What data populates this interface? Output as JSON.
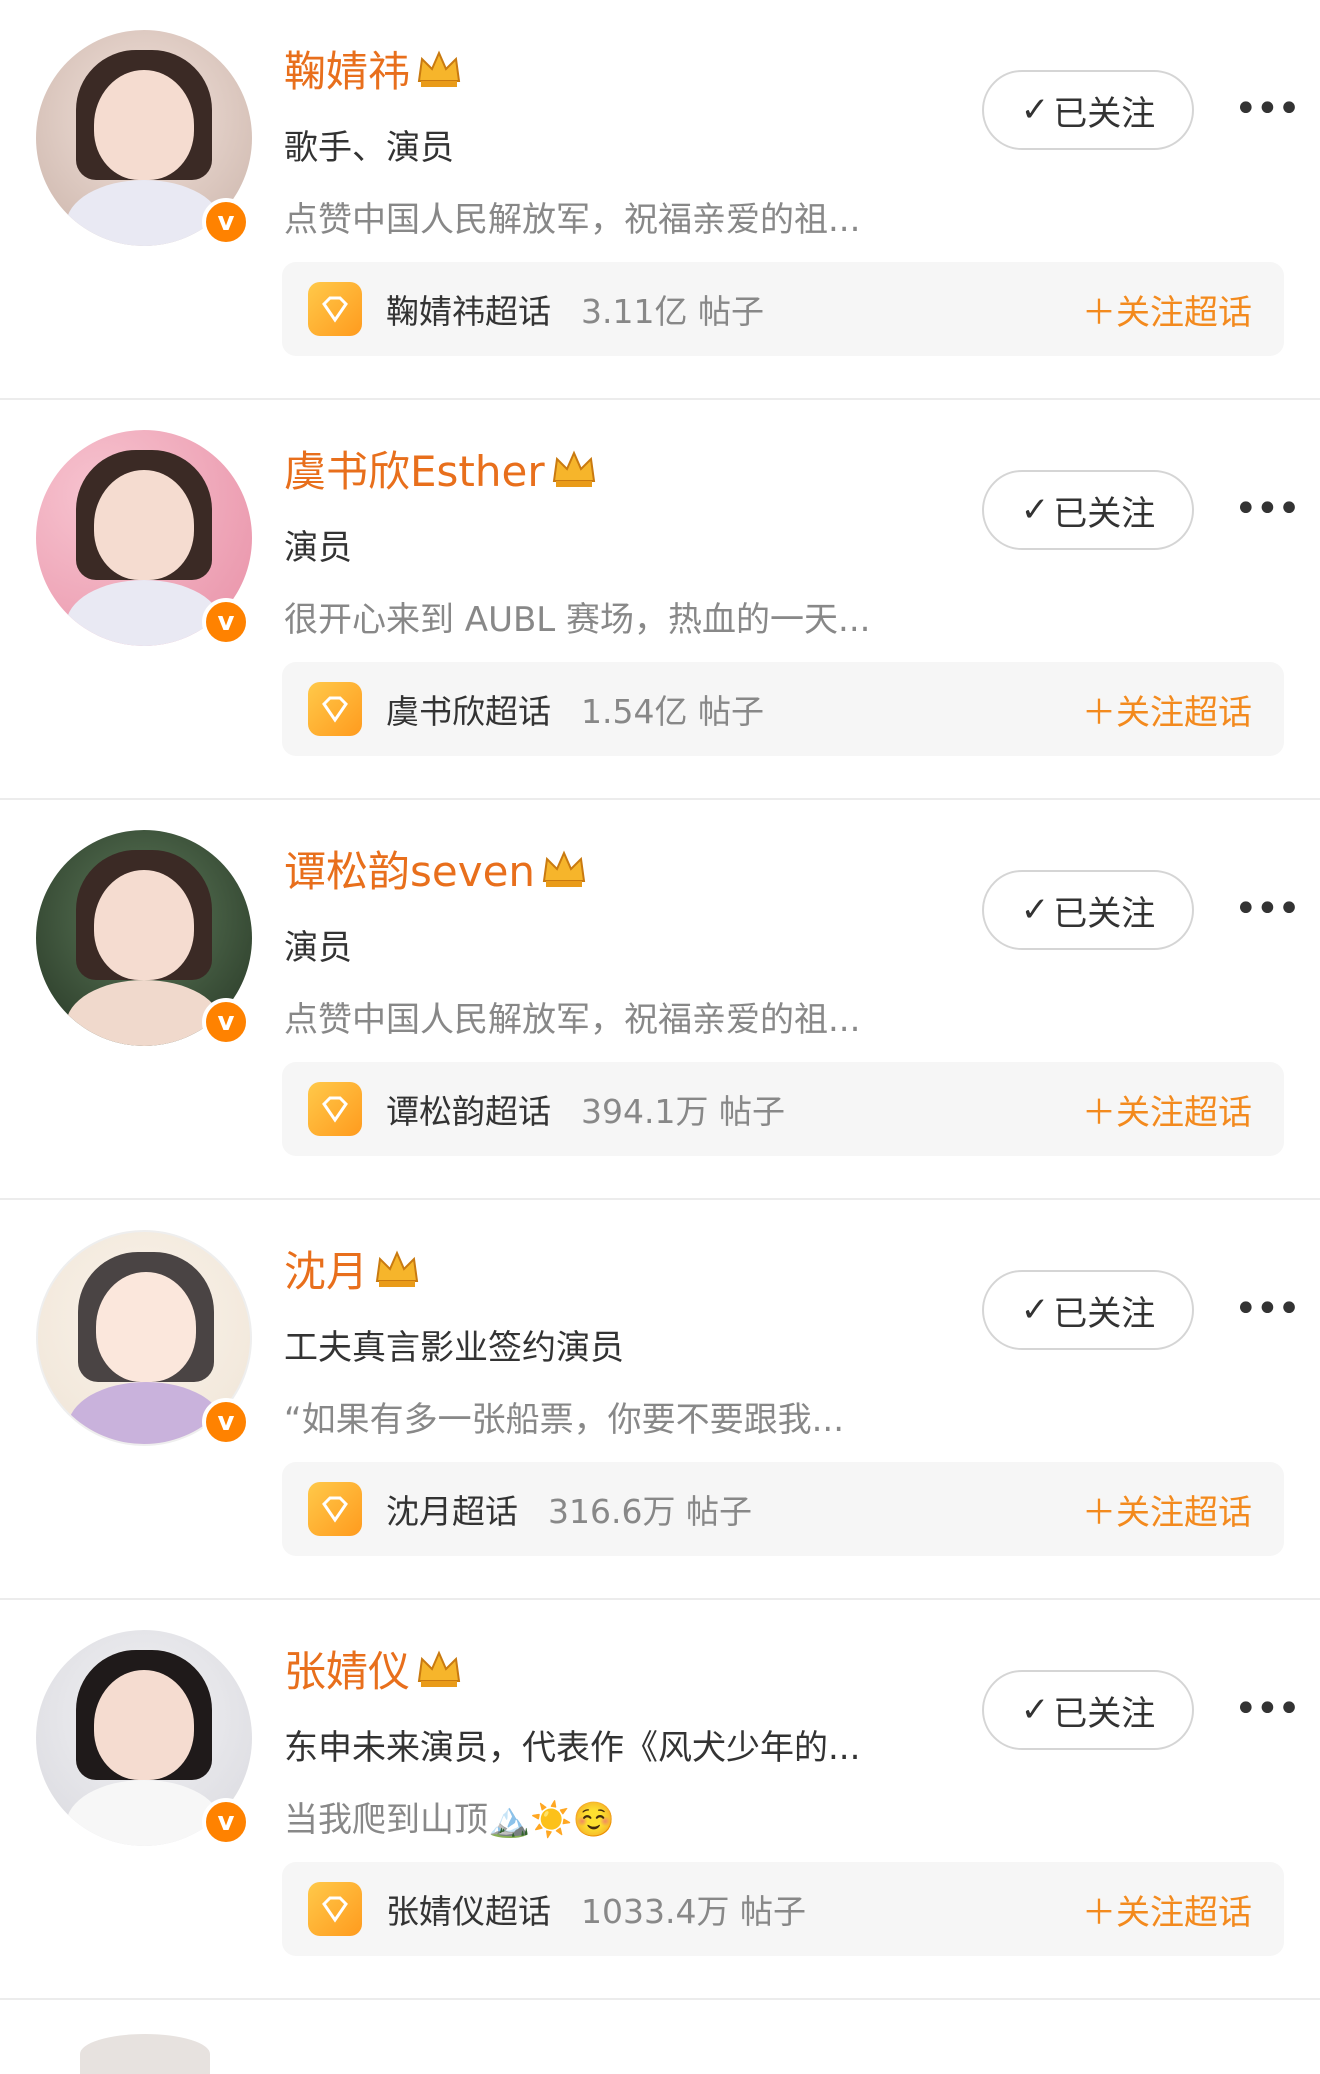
{
  "users": [
    {
      "name": "鞠婧祎",
      "desc": "歌手、演员",
      "note": "点赞中国人民解放军，祝福亲爱的祖...",
      "follow_label": "已关注",
      "topic": {
        "name": "鞠婧祎超话",
        "count": "3.11亿 帖子",
        "join": "关注超话"
      }
    },
    {
      "name": "虞书欣Esther",
      "desc": "演员",
      "note": "很开心来到 AUBL 赛场，热血的一天...",
      "follow_label": "已关注",
      "topic": {
        "name": "虞书欣超话",
        "count": "1.54亿 帖子",
        "join": "关注超话"
      }
    },
    {
      "name": "谭松韵seven",
      "desc": "演员",
      "note": "点赞中国人民解放军，祝福亲爱的祖...",
      "follow_label": "已关注",
      "topic": {
        "name": "谭松韵超话",
        "count": "394.1万 帖子",
        "join": "关注超话"
      }
    },
    {
      "name": "沈月",
      "desc": "工夫真言影业签约演员",
      "note": "“如果有多一张船票，你要不要跟我...",
      "follow_label": "已关注",
      "topic": {
        "name": "沈月超话",
        "count": "316.6万 帖子",
        "join": "关注超话"
      }
    },
    {
      "name": "张婧仪",
      "desc": "东申未来演员，代表作《风犬少年的...",
      "note": "当我爬到山顶🏔️☀️☺️",
      "follow_label": "已关注",
      "topic": {
        "name": "张婧仪超话",
        "count": "1033.4万 帖子",
        "join": "关注超话"
      }
    }
  ],
  "colors": {
    "accent": "#e86f1c",
    "join": "#f38a1e",
    "badge": "#ff8200",
    "topic_icon": "#ffb02e"
  },
  "icons": {
    "verified": "verified-v-icon",
    "crown": "crown-icon",
    "check": "check-icon",
    "more": "more-icon",
    "topic": "diamond-icon"
  }
}
